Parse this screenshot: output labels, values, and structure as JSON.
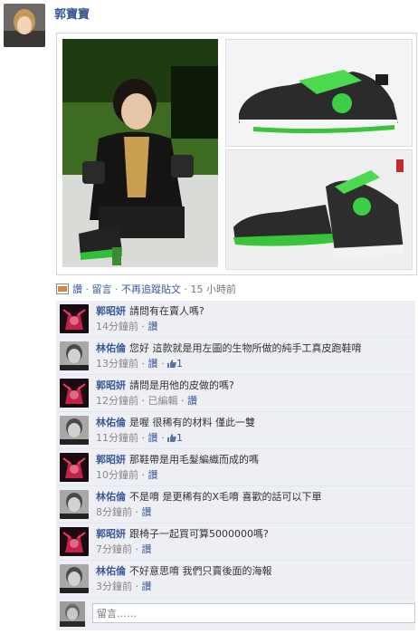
{
  "post": {
    "author": "郭寶寶",
    "actions": {
      "like": "讚",
      "comment": "留言",
      "unfollow": "不再追蹤貼文",
      "time": "15 小時前",
      "dot": "·"
    }
  },
  "comments": [
    {
      "name": "郭昭妍",
      "text": "請問有在賣人嗎?",
      "time": "14分鐘前",
      "like": "讚",
      "likes": "",
      "edited": ""
    },
    {
      "name": "林佑倫",
      "text": "您好 這款就是用左圖的生物所做的純手工真皮跑鞋唷",
      "time": "13分鐘前",
      "like": "讚",
      "likes": "1",
      "edited": ""
    },
    {
      "name": "郭昭妍",
      "text": "請問是用他的皮做的嗎?",
      "time": "12分鐘前",
      "like": "讚",
      "likes": "",
      "edited": "已編輯"
    },
    {
      "name": "林佑倫",
      "text": "是喔 很稀有的材料 僅此一雙",
      "time": "11分鐘前",
      "like": "讚",
      "likes": "1",
      "edited": ""
    },
    {
      "name": "郭昭妍",
      "text": "那鞋帶是用毛髮編織而成的嗎",
      "time": "10分鐘前",
      "like": "讚",
      "likes": "",
      "edited": ""
    },
    {
      "name": "林佑倫",
      "text": "不是唷 是更稀有的X毛唷 喜歡的話可以下單",
      "time": "8分鐘前",
      "like": "讚",
      "likes": "",
      "edited": ""
    },
    {
      "name": "郭昭妍",
      "text": "跟椅子一起買可算5000000嗎?",
      "time": "7分鐘前",
      "like": "讚",
      "likes": "",
      "edited": ""
    },
    {
      "name": "林佑倫",
      "text": "不好意思唷 我們只賣後面的海報",
      "time": "3分鐘前",
      "like": "讚",
      "likes": "",
      "edited": ""
    }
  ],
  "reply": {
    "placeholder": "留言……"
  },
  "colors": {
    "link": "#3b5998",
    "comment_bg": "#edeff4"
  }
}
